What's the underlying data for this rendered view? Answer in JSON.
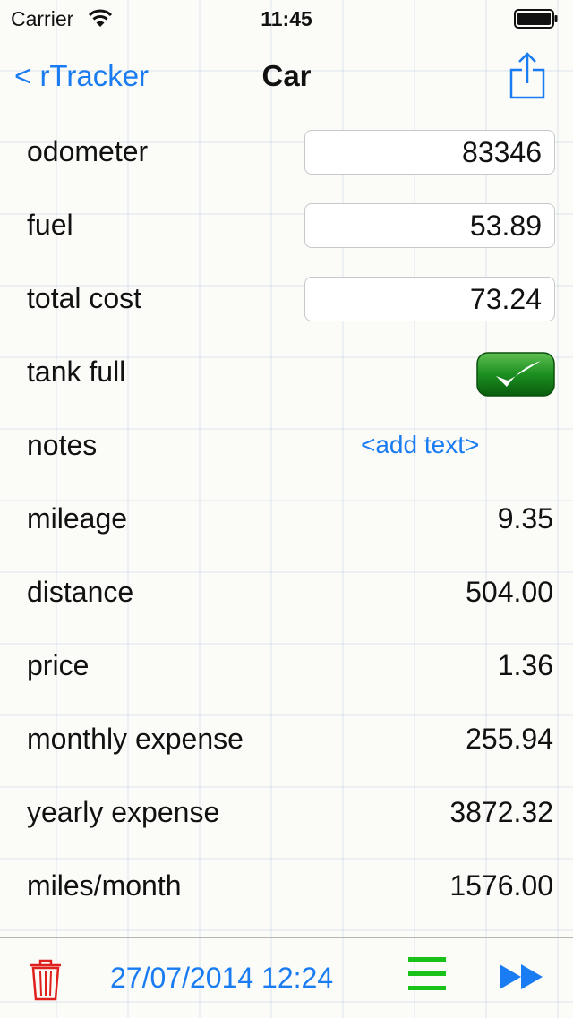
{
  "status_bar": {
    "carrier": "Carrier",
    "time": "11:45"
  },
  "nav": {
    "back_label": "< rTracker",
    "title": "Car",
    "share_icon": "share-icon"
  },
  "rows": [
    {
      "label": "odometer",
      "type": "input",
      "value": "83346"
    },
    {
      "label": "fuel",
      "type": "input",
      "value": "53.89"
    },
    {
      "label": "total cost",
      "type": "input",
      "value": "73.24"
    },
    {
      "label": "tank full",
      "type": "checkbox",
      "checked": true
    },
    {
      "label": "notes",
      "type": "link",
      "value": "<add text>"
    },
    {
      "label": "mileage",
      "type": "value",
      "value": "9.35"
    },
    {
      "label": "distance",
      "type": "value",
      "value": "504.00"
    },
    {
      "label": "price",
      "type": "value",
      "value": "1.36"
    },
    {
      "label": "monthly expense",
      "type": "value",
      "value": "255.94"
    },
    {
      "label": "yearly expense",
      "type": "value",
      "value": "3872.32"
    },
    {
      "label": "miles/month",
      "type": "value",
      "value": "1576.00"
    }
  ],
  "toolbar": {
    "date": "27/07/2014 12:24",
    "trash_icon": "trash-icon",
    "menu_icon": "list-icon",
    "forward_icon": "fast-forward-icon"
  },
  "colors": {
    "accent": "#1a7cf2",
    "trash": "#e0201c",
    "menu": "#18c218",
    "checkbox": "#0c7a12"
  }
}
